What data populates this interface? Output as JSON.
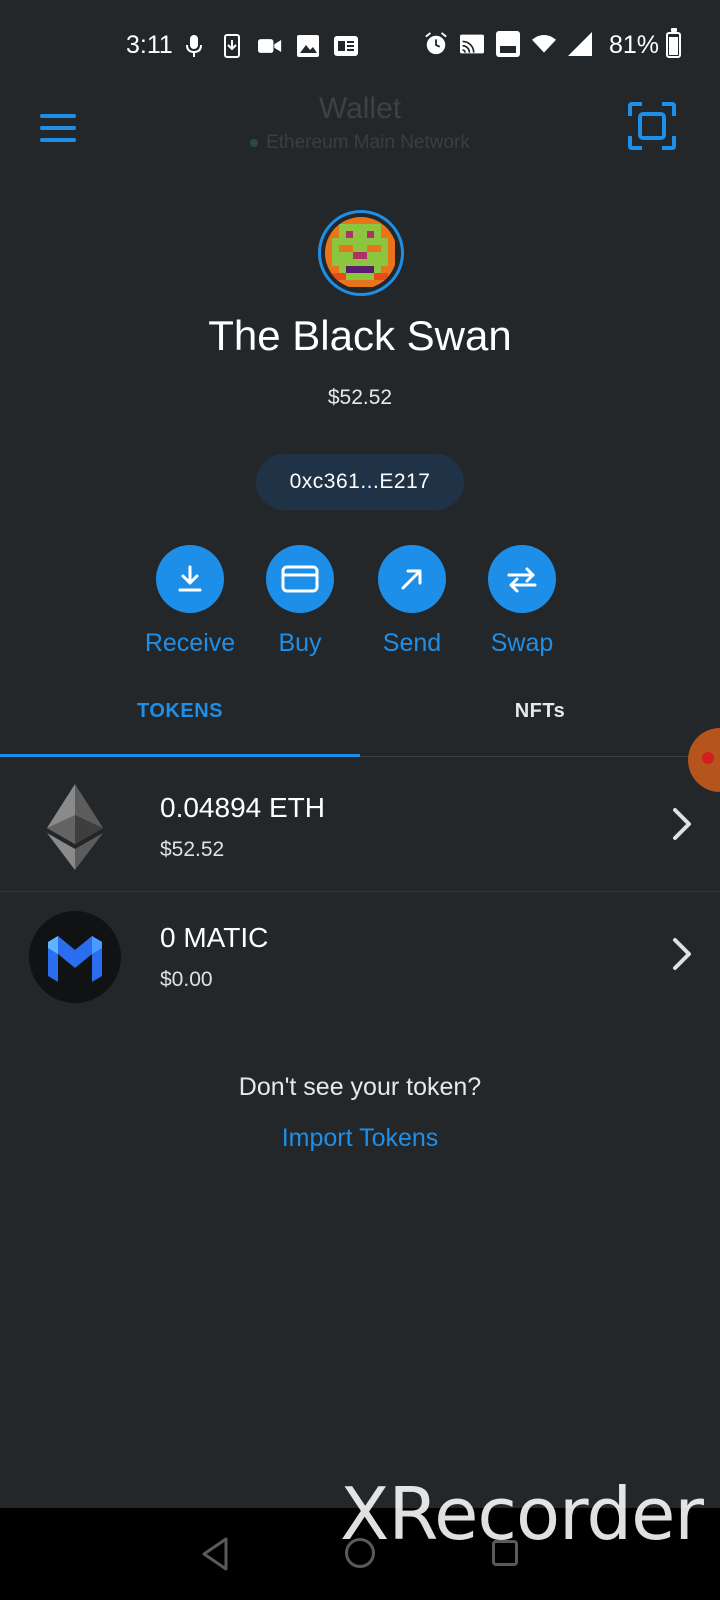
{
  "status_bar": {
    "time": "3:11",
    "battery": "81%",
    "battery_level": 0.81
  },
  "header": {
    "title": "Wallet",
    "network": "Ethereum Main Network"
  },
  "account": {
    "name": "The Black Swan",
    "balance": "$52.52",
    "address": "0xc361...E217"
  },
  "actions": [
    {
      "label": "Receive",
      "icon": "download-icon"
    },
    {
      "label": "Buy",
      "icon": "card-icon"
    },
    {
      "label": "Send",
      "icon": "arrow-up-right-icon"
    },
    {
      "label": "Swap",
      "icon": "swap-icon"
    }
  ],
  "tabs": [
    {
      "label": "TOKENS",
      "active": true
    },
    {
      "label": "NFTs",
      "active": false
    }
  ],
  "tokens": [
    {
      "amount": "0.04894 ETH",
      "fiat": "$52.52",
      "icon": "ethereum-icon"
    },
    {
      "amount": "0 MATIC",
      "fiat": "$0.00",
      "icon": "polygon-matic-icon"
    }
  ],
  "import": {
    "question": "Don't see your token?",
    "link": "Import Tokens"
  },
  "watermark": "XRecorder",
  "colors": {
    "background": "#24272a",
    "accent": "#1e8fe8",
    "address_pill": "#1f3246"
  }
}
